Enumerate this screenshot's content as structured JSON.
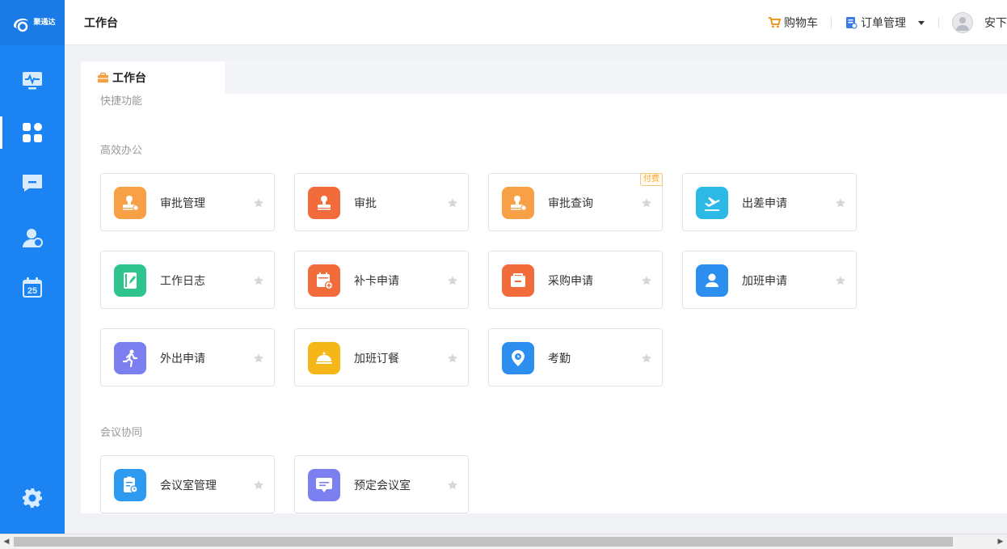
{
  "app": {
    "logo_text": "聚通达",
    "page_title": "工作台"
  },
  "header": {
    "cart_label": "购物车",
    "orders_label": "订单管理",
    "user_name": "安下",
    "accent": "#1c84f2"
  },
  "sidebar": {
    "items": [
      {
        "icon": "monitor-icon",
        "active": false
      },
      {
        "icon": "dashboard-grid-icon",
        "active": true
      },
      {
        "icon": "message-icon",
        "active": false
      },
      {
        "icon": "contacts-icon",
        "active": false
      },
      {
        "icon": "calendar-icon",
        "label": "25",
        "active": false
      },
      {
        "icon": "gear-icon",
        "active": false
      }
    ]
  },
  "tabs": [
    {
      "label": "工作台",
      "icon": "briefcase-icon",
      "active": true
    }
  ],
  "sections": {
    "quick": "快捷功能",
    "office": "高效办公",
    "meeting": "会议协同"
  },
  "office_cards": [
    {
      "label": "审批管理",
      "icon": "stamp-gear-icon",
      "color": "#f7a046"
    },
    {
      "label": "审批",
      "icon": "stamp-icon",
      "color": "#f26b3a"
    },
    {
      "label": "审批查询",
      "icon": "stamp-gear-icon",
      "color": "#f7a046",
      "badge": "付费"
    },
    {
      "label": "出差申请",
      "icon": "plane-icon",
      "color": "#2cb9e6"
    },
    {
      "label": "工作日志",
      "icon": "notebook-icon",
      "color": "#2fc48d"
    },
    {
      "label": "补卡申请",
      "icon": "calendar-plus-icon",
      "color": "#f26b3a"
    },
    {
      "label": "采购申请",
      "icon": "cart-icon",
      "color": "#f26b3a"
    },
    {
      "label": "加班申请",
      "icon": "person-icon",
      "color": "#2c8ff0"
    },
    {
      "label": "外出申请",
      "icon": "runner-icon",
      "color": "#7b7ff0"
    },
    {
      "label": "加班订餐",
      "icon": "cloche-icon",
      "color": "#f5b617"
    },
    {
      "label": "考勤",
      "icon": "location-clock-icon",
      "color": "#2c8ff0"
    }
  ],
  "meeting_cards": [
    {
      "label": "会议室管理",
      "icon": "meeting-manage-icon",
      "color": "#2c9af0"
    },
    {
      "label": "预定会议室",
      "icon": "meeting-book-icon",
      "color": "#7b7ff0"
    }
  ]
}
